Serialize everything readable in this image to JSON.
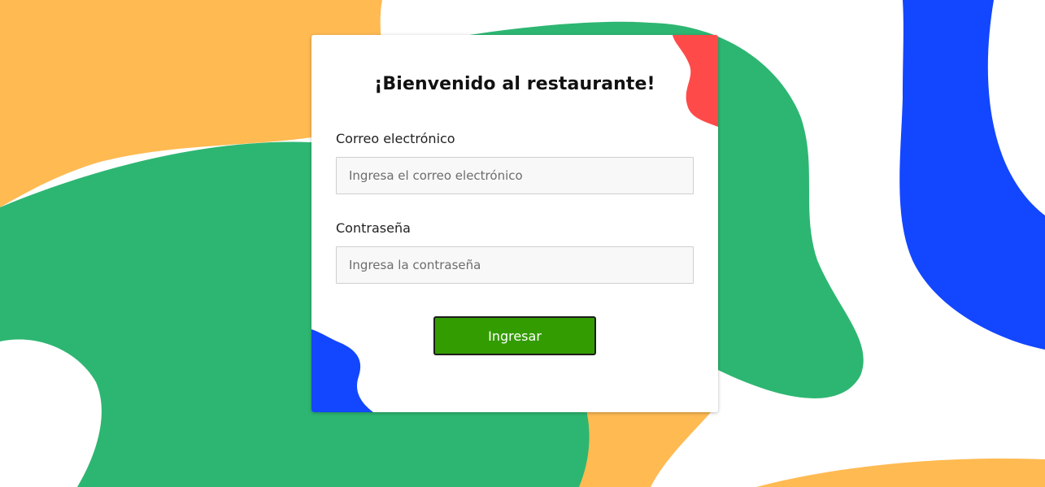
{
  "colors": {
    "yellow": "#FFBA52",
    "green": "#2DB672",
    "blue": "#1346FF",
    "red": "#FF4A4A",
    "button": "#339C00"
  },
  "login": {
    "title": "¡Bienvenido al restaurante!",
    "email_label": "Correo electrónico",
    "email_placeholder": "Ingresa el correo electrónico",
    "password_label": "Contraseña",
    "password_placeholder": "Ingresa la contraseña",
    "submit_label": "Ingresar"
  }
}
